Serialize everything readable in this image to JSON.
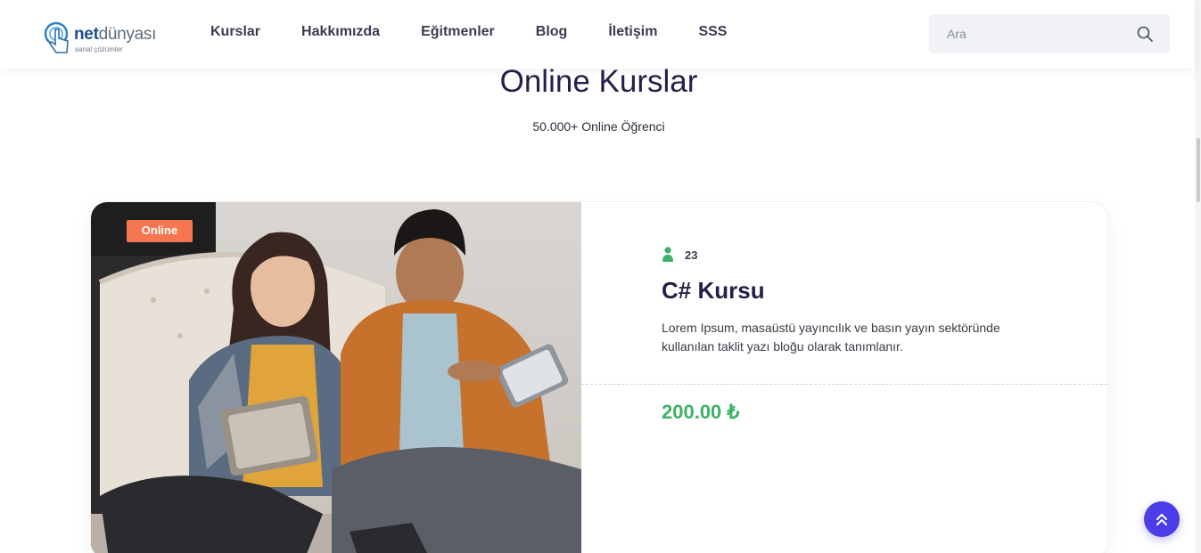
{
  "header": {
    "logo": {
      "brand_bold": "net",
      "brand_light": "dünyası",
      "tagline": "sanal çözümler"
    },
    "nav": [
      "Kurslar",
      "Hakkımızda",
      "Eğitmenler",
      "Blog",
      "İletişim",
      "SSS"
    ],
    "search": {
      "placeholder": "Ara",
      "icon": "search-icon"
    }
  },
  "section": {
    "title": "Online Kurslar",
    "subtitle": "50.000+ Online Öğrenci"
  },
  "course": {
    "badge": "Online",
    "student_count": "23",
    "student_icon": "user-icon",
    "title": "C# Kursu",
    "description": "Lorem Ipsum, masaüstü yayıncılık ve basın yayın sektöründe kullanılan taklit yazı bloğu olarak tanımlanır.",
    "price": "200.00 ₺"
  },
  "colors": {
    "title": "#241f4c",
    "badge": "#f6764f",
    "price": "#3db166",
    "scroll_top_button": "#4c3ee6"
  },
  "scroll_top_icon": "double-chevron-up-icon"
}
